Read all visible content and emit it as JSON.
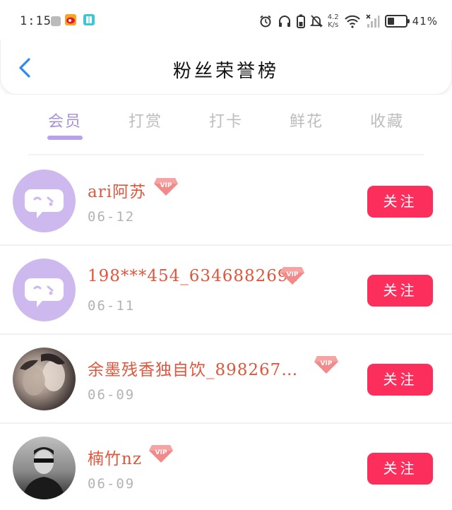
{
  "status_bar": {
    "time": "1:15",
    "net_speed_value": "4.2",
    "net_speed_unit": "K/s",
    "battery_percent": 41,
    "battery_text": "41%",
    "icons": [
      "sim-icon",
      "weibo-icon",
      "book-app-icon",
      "alarm-icon",
      "headphones-icon",
      "battery-saver-icon",
      "mute-icon",
      "wifi-icon",
      "signal-off-icon",
      "battery-icon"
    ]
  },
  "header": {
    "title": "粉丝荣誉榜",
    "back_icon": "chevron-left-icon"
  },
  "tabs": [
    {
      "label": "会员",
      "active": true
    },
    {
      "label": "打赏",
      "active": false
    },
    {
      "label": "打卡",
      "active": false
    },
    {
      "label": "鲜花",
      "active": false
    },
    {
      "label": "收藏",
      "active": false
    }
  ],
  "members": [
    {
      "name": "ari阿苏",
      "date": "06-12",
      "vip": true,
      "avatar": "default-chat-avatar",
      "follow_label": "关注"
    },
    {
      "name": "198***454_6346882691",
      "date": "06-11",
      "vip": true,
      "avatar": "default-chat-avatar",
      "follow_label": "关注"
    },
    {
      "name": "余墨残香独自饮_898267…",
      "date": "06-09",
      "vip": true,
      "avatar": "photo-avatar",
      "follow_label": "关注"
    },
    {
      "name": "楠竹nz",
      "date": "06-09",
      "vip": true,
      "avatar": "photo-avatar",
      "follow_label": "关注"
    }
  ],
  "vip_badge_text": "VIP",
  "colors": {
    "accent_purple": "#a890d8",
    "follow_button": "#fc2f5c",
    "name_color": "#e0563c",
    "vip_badge": "#f07b7b"
  }
}
